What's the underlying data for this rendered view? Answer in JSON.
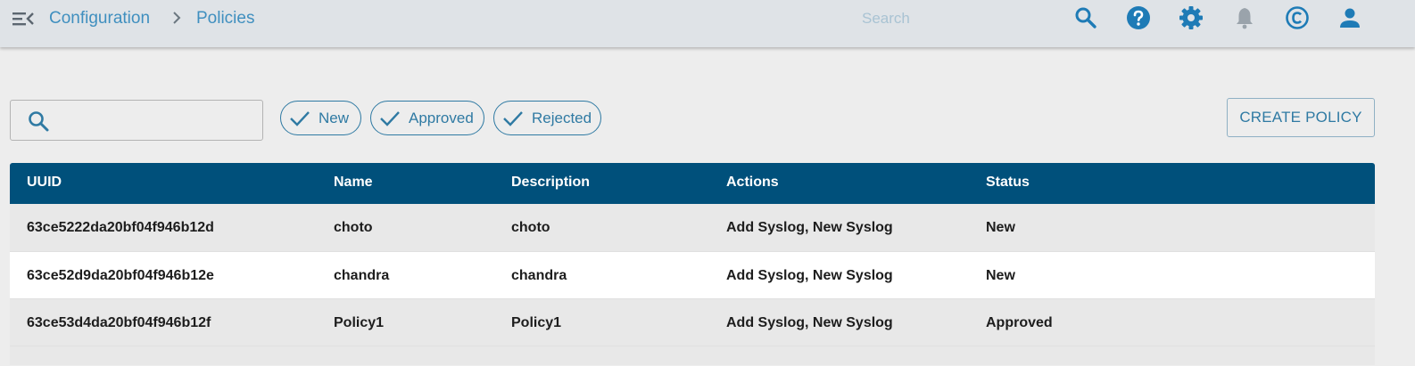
{
  "breadcrumb": {
    "parent": "Configuration",
    "current": "Policies"
  },
  "topbar": {
    "search_placeholder": "Search",
    "icons": [
      "menu-collapse-icon",
      "search-icon",
      "help-icon",
      "settings-gear-icon",
      "bell-icon",
      "copyright-icon",
      "user-account-icon"
    ]
  },
  "filters": {
    "search_value": "",
    "chips": [
      {
        "label": "New",
        "checked": true
      },
      {
        "label": "Approved",
        "checked": true
      },
      {
        "label": "Rejected",
        "checked": true
      }
    ],
    "create_button": "CREATE POLICY"
  },
  "table": {
    "columns": [
      "UUID",
      "Name",
      "Description",
      "Actions",
      "Status"
    ],
    "rows": [
      [
        "63ce5222da20bf04f946b12d",
        "choto",
        "choto",
        "Add Syslog, New Syslog",
        "New"
      ],
      [
        "63ce52d9da20bf04f946b12e",
        "chandra",
        "chandra",
        "Add Syslog, New Syslog",
        "New"
      ],
      [
        "63ce53d4da20bf04f946b12f",
        "Policy1",
        "Policy1",
        "Add Syslog, New Syslog",
        "Approved"
      ]
    ]
  },
  "colors": {
    "accent": "#3f8fbf",
    "header_bg": "#00507b",
    "topbar_bg": "#dfe3e7",
    "page_bg": "#ededed",
    "icon_blue": "#1e7bb6",
    "icon_disabled": "#9aa3ab"
  }
}
